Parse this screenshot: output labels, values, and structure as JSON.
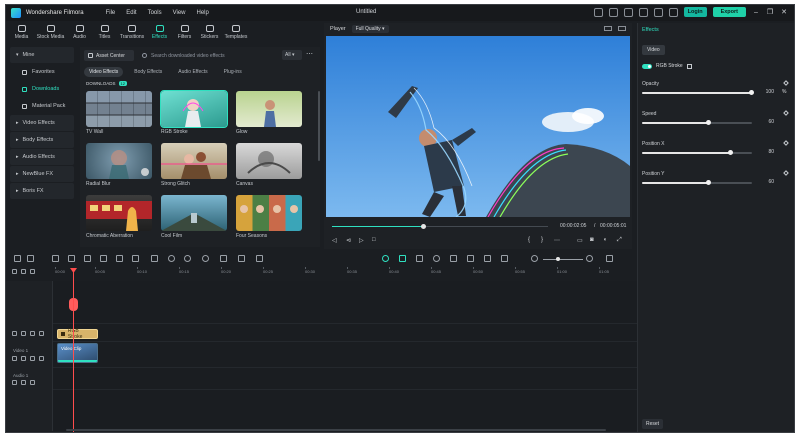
{
  "app": {
    "name": "Wondershare Filmora",
    "title": "Untitled",
    "menu": [
      "File",
      "Edit",
      "Tools",
      "View",
      "Help"
    ],
    "login_label": "Login",
    "export_label": "Export"
  },
  "toolbar": {
    "tabs": [
      {
        "label": "Media",
        "icon": "media-icon"
      },
      {
        "label": "Stock Media",
        "icon": "stock-media-icon"
      },
      {
        "label": "Audio",
        "icon": "audio-icon"
      },
      {
        "label": "Titles",
        "icon": "titles-icon"
      },
      {
        "label": "Transitions",
        "icon": "transitions-icon"
      },
      {
        "label": "Effects",
        "icon": "effects-icon",
        "active": true
      },
      {
        "label": "Filters",
        "icon": "filters-icon"
      },
      {
        "label": "Stickers",
        "icon": "stickers-icon"
      },
      {
        "label": "Templates",
        "icon": "templates-icon"
      }
    ]
  },
  "sidebar": {
    "items": [
      {
        "label": "Mine",
        "type": "group"
      },
      {
        "label": "Favorites",
        "type": "sub"
      },
      {
        "label": "Downloads",
        "type": "sub",
        "selected": true
      },
      {
        "label": "Material Pack",
        "type": "sub"
      },
      {
        "label": "Video Effects",
        "type": "group"
      },
      {
        "label": "Body Effects",
        "type": "group"
      },
      {
        "label": "Audio Effects",
        "type": "group"
      },
      {
        "label": "NewBlue FX",
        "type": "group"
      },
      {
        "label": "Boris FX",
        "type": "group"
      }
    ]
  },
  "browser": {
    "asset_center": "Asset Center",
    "search_placeholder": "Search downloaded video effects",
    "filter_value": "All",
    "subtabs": [
      "Video Effects",
      "Body Effects",
      "Audio Effects",
      "Plug-ins"
    ],
    "section_label": "DOWNLOADS",
    "section_count": "12",
    "effects": [
      {
        "label": "TV Wall"
      },
      {
        "label": "RGB Stroke",
        "selected": true
      },
      {
        "label": "Glow"
      },
      {
        "label": "Radial Blur"
      },
      {
        "label": "Strong Glitch"
      },
      {
        "label": "Canvas"
      },
      {
        "label": "Chromatic Aberration"
      },
      {
        "label": "Cool Film"
      },
      {
        "label": "Four Seasons"
      }
    ]
  },
  "player": {
    "label": "Player",
    "quality": "Full Quality",
    "current_time": "00:00:02:05",
    "separator": "/",
    "total_time": "00:00:05:01",
    "progress": 0.42
  },
  "properties": {
    "tab": "Effects",
    "subtab": "Video",
    "effect_name": "RGB Stroke",
    "params": [
      {
        "label": "Opacity",
        "value": "100",
        "unit": "%",
        "fraction": 1.0
      },
      {
        "label": "Speed",
        "value": "60",
        "unit": "",
        "fraction": 0.6
      },
      {
        "label": "Position X",
        "value": "80",
        "unit": "",
        "fraction": 0.8
      },
      {
        "label": "Position Y",
        "value": "60",
        "unit": "",
        "fraction": 0.6
      }
    ],
    "reset_label": "Reset"
  },
  "timeline": {
    "ruler": [
      "00:00",
      "00:05",
      "00:10",
      "00:15",
      "00:20",
      "00:25",
      "00:30",
      "00:35",
      "00:40",
      "00:45",
      "00:50",
      "00:55",
      "01:00",
      "01:05"
    ],
    "tracks": [
      {
        "label": "Video 1"
      },
      {
        "label": "Audio 1"
      }
    ],
    "fx_clip_label": "RGB Stroke",
    "video_clip_label": "Video Clip"
  },
  "colors": {
    "accent": "#2fe0c0",
    "playhead": "#ff4d4d",
    "fx_clip": "#d8b46a"
  }
}
